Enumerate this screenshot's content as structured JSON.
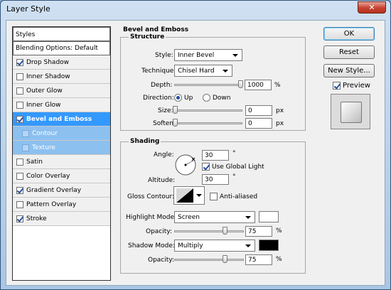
{
  "window": {
    "title": "Layer Style",
    "close_glyph": "✕"
  },
  "styles_panel": {
    "header": "Styles",
    "blending_options": "Blending Options: Default",
    "items": [
      {
        "label": "Drop Shadow",
        "checked": true
      },
      {
        "label": "Inner Shadow",
        "checked": false
      },
      {
        "label": "Outer Glow",
        "checked": false
      },
      {
        "label": "Inner Glow",
        "checked": false
      },
      {
        "label": "Bevel and Emboss",
        "checked": true,
        "selected": true
      },
      {
        "label": "Contour",
        "checked": false,
        "sub": true
      },
      {
        "label": "Texture",
        "checked": false,
        "sub": true
      },
      {
        "label": "Satin",
        "checked": false
      },
      {
        "label": "Color Overlay",
        "checked": false
      },
      {
        "label": "Gradient Overlay",
        "checked": true
      },
      {
        "label": "Pattern Overlay",
        "checked": false
      },
      {
        "label": "Stroke",
        "checked": true
      }
    ]
  },
  "bevel": {
    "section_title": "Bevel and Emboss",
    "structure": {
      "title": "Structure",
      "style_label": "Style:",
      "style_value": "Inner Bevel",
      "technique_label": "Technique:",
      "technique_value": "Chisel Hard",
      "depth_label": "Depth:",
      "depth_value": "1000",
      "depth_unit": "%",
      "depth_level": 1.0,
      "direction_label": "Direction:",
      "direction_up": "Up",
      "direction_down": "Down",
      "size_label": "Size:",
      "size_value": "0",
      "size_unit": "px",
      "soften_label": "Soften:",
      "soften_value": "0",
      "soften_unit": "px"
    },
    "shading": {
      "title": "Shading",
      "angle_label": "Angle:",
      "angle_value": "30",
      "degree": "°",
      "use_global_light": "Use Global Light",
      "altitude_label": "Altitude:",
      "altitude_value": "30",
      "gloss_label": "Gloss Contour:",
      "anti_aliased": "Anti-aliased",
      "highlight_label": "Highlight Mode:",
      "highlight_value": "Screen",
      "highlight_color": "#ffffff",
      "opacity_label": "Opacity:",
      "highlight_opacity": "75",
      "shadow_label": "Shadow Mode:",
      "shadow_value": "Multiply",
      "shadow_color": "#000000",
      "shadow_opacity": "75",
      "percent": "%"
    }
  },
  "buttons": {
    "ok": "OK",
    "reset": "Reset",
    "new_style": "New Style...",
    "preview": "Preview"
  },
  "colors": {
    "selected_row": "#3399ff",
    "sub_row": "#8cc0ef",
    "highlight": "#ffffff",
    "shadow": "#000000"
  }
}
